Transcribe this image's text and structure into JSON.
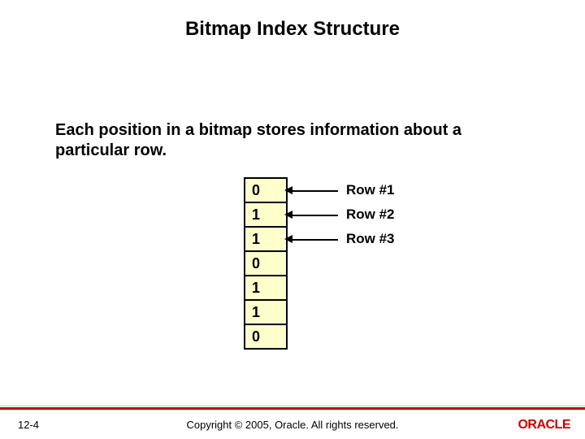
{
  "title": "Bitmap Index Structure",
  "body": "Each position in a bitmap stores information about a particular row.",
  "cells": [
    {
      "value": "0",
      "label": "Row #1"
    },
    {
      "value": "1",
      "label": "Row #2"
    },
    {
      "value": "1",
      "label": "Row #3"
    },
    {
      "value": "0",
      "label": ""
    },
    {
      "value": "1",
      "label": ""
    },
    {
      "value": "1",
      "label": ""
    },
    {
      "value": "0",
      "label": ""
    }
  ],
  "footer": {
    "page": "12-4",
    "copyright": "Copyright © 2005, Oracle. All rights reserved.",
    "brand": "ORACLE"
  }
}
